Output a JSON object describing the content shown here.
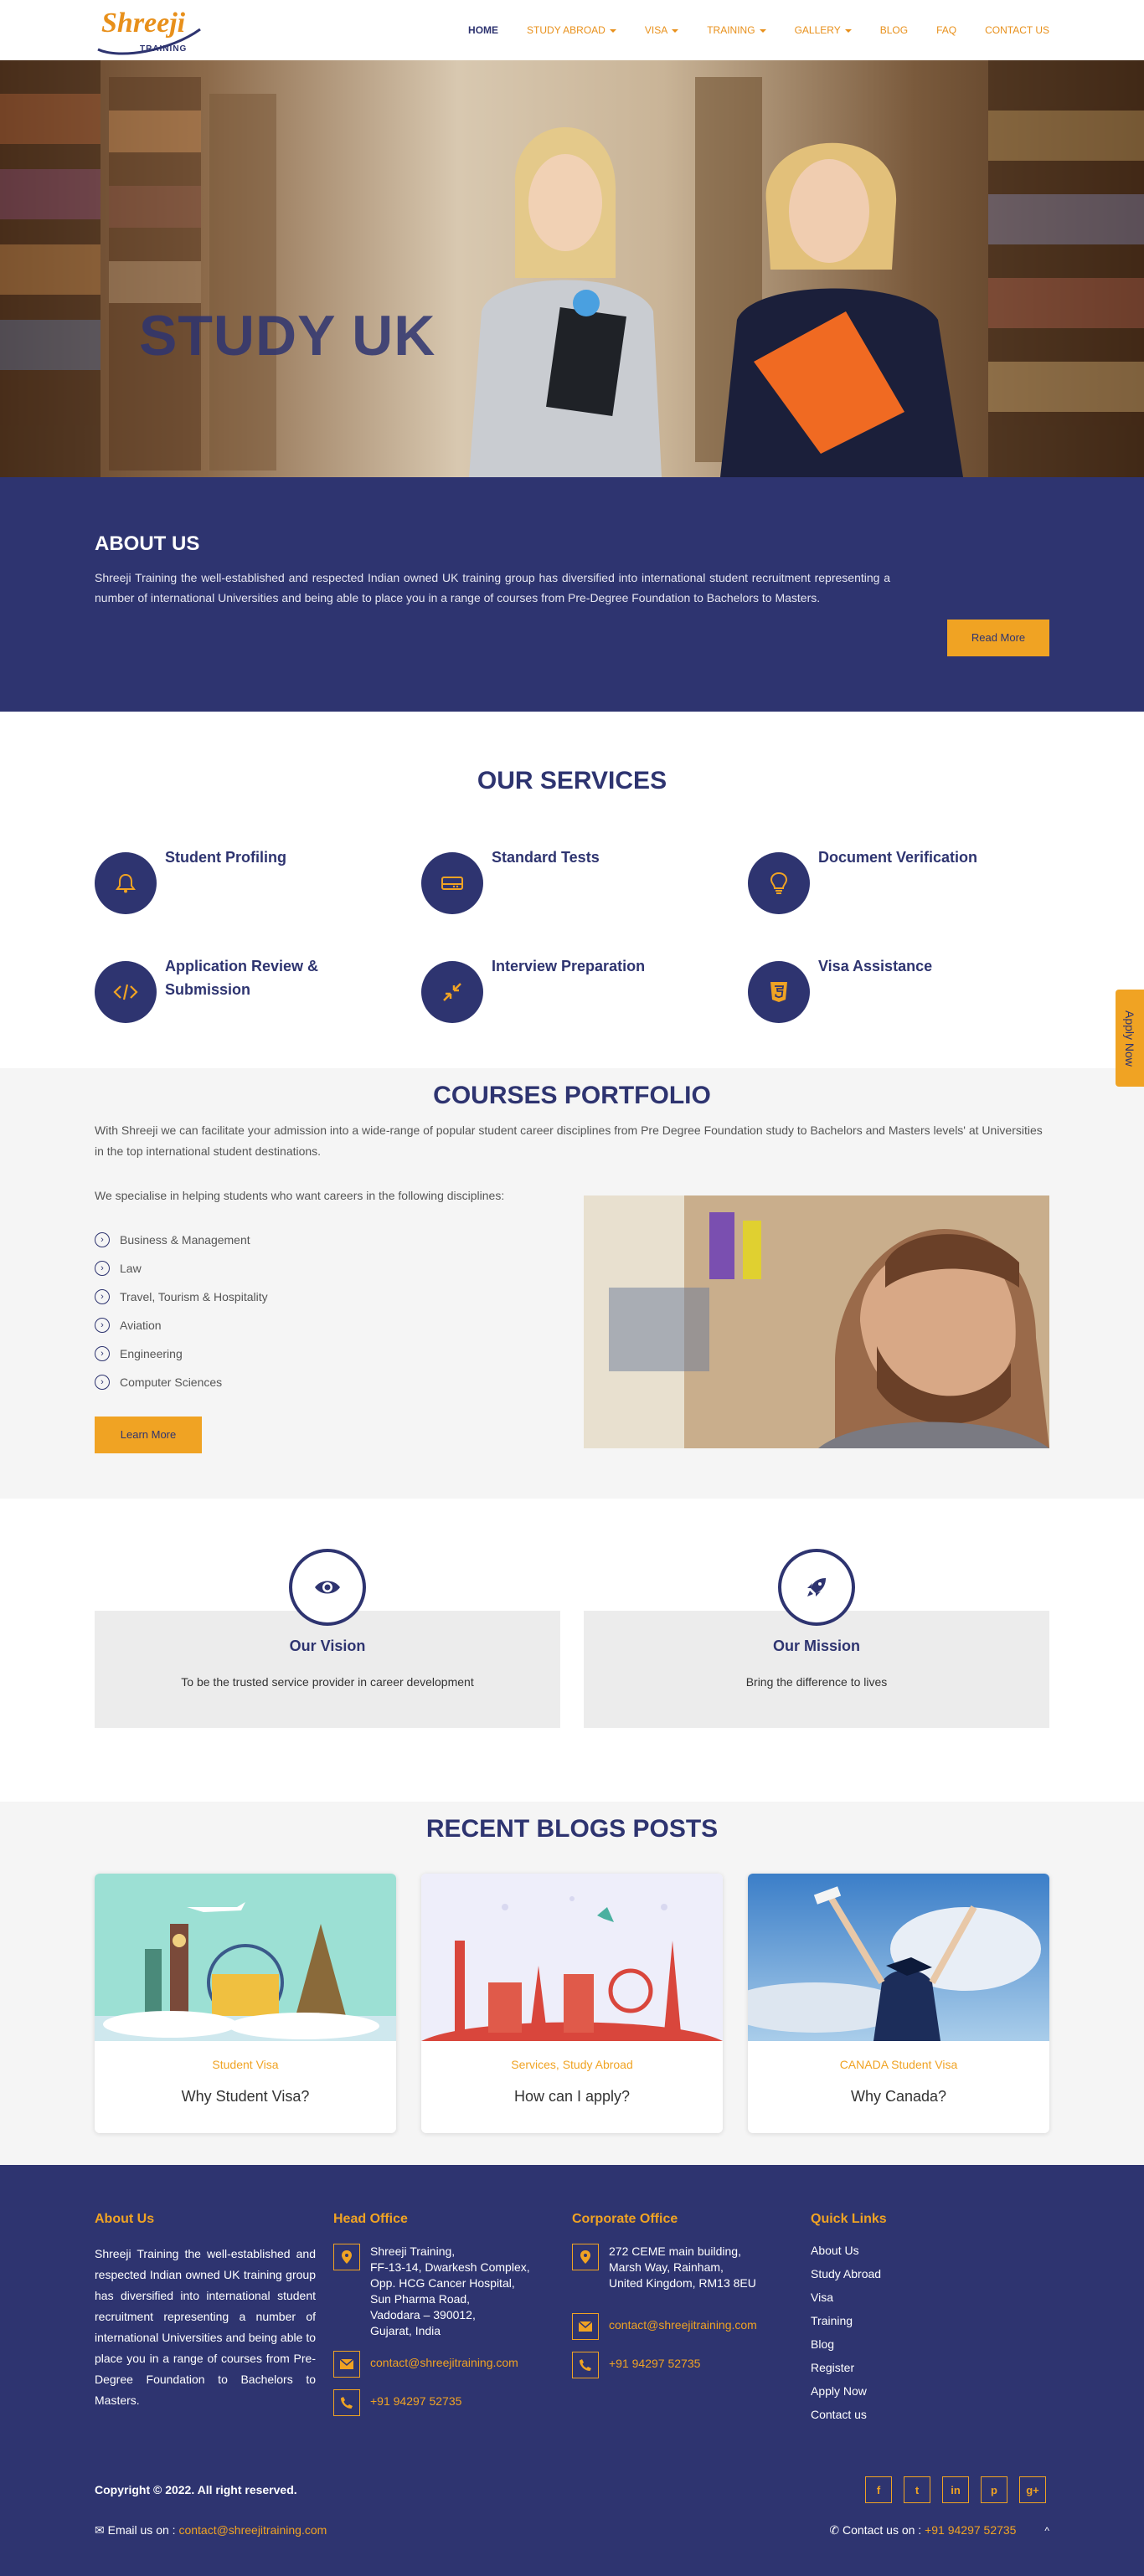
{
  "header": {
    "logo_text": "Shreeji",
    "logo_sub": "TRAINING",
    "nav": [
      {
        "label": "HOME",
        "active": true,
        "dropdown": false
      },
      {
        "label": "STUDY ABROAD",
        "active": false,
        "dropdown": true
      },
      {
        "label": "VISA",
        "active": false,
        "dropdown": true
      },
      {
        "label": "TRAINING",
        "active": false,
        "dropdown": true
      },
      {
        "label": "GALLERY",
        "active": false,
        "dropdown": true
      },
      {
        "label": "BLOG",
        "active": false,
        "dropdown": false
      },
      {
        "label": "FAQ",
        "active": false,
        "dropdown": false
      },
      {
        "label": "CONTACT US",
        "active": false,
        "dropdown": false
      }
    ]
  },
  "hero": {
    "title": "STUDY UK"
  },
  "about": {
    "heading": "ABOUT US",
    "text": "Shreeji Training the well-established and respected Indian owned UK training group has diversified into international student recruitment representing a number of international Universities and being able to place you in a range of courses from Pre-Degree Foundation to Bachelors to Masters.",
    "button": "Read More"
  },
  "services": {
    "heading": "OUR SERVICES",
    "items": [
      {
        "title": "Student Profiling",
        "icon": "bell-icon"
      },
      {
        "title": "Standard Tests",
        "icon": "hard-drive-icon"
      },
      {
        "title": "Document Verification",
        "icon": "lightbulb-icon"
      },
      {
        "title": "Application Review & Submission",
        "icon": "code-icon"
      },
      {
        "title": "Interview Preparation",
        "icon": "compress-icon"
      },
      {
        "title": "Visa Assistance",
        "icon": "html5-icon"
      }
    ]
  },
  "apply_tab": "Apply Now",
  "courses": {
    "heading": "COURSES PORTFOLIO",
    "intro": "With Shreeji we can facilitate your admission into a wide-range of popular student career disciplines from Pre Degree Foundation study to Bachelors and Masters levels' at Universities in the top international student destinations.",
    "lead": "We specialise in helping students who want careers in the following disciplines:",
    "disciplines": [
      "Business & Management",
      "Law",
      "Travel, Tourism & Hospitality",
      "Aviation",
      "Engineering",
      "Computer Sciences"
    ],
    "button": "Learn More"
  },
  "vision": {
    "title": "Our Vision",
    "text": "To be the trusted service provider in career development",
    "icon": "eye-icon"
  },
  "mission": {
    "title": "Our Mission",
    "text": "Bring the difference to lives",
    "icon": "rocket-icon"
  },
  "blogs": {
    "heading": "RECENT BLOGS POSTS",
    "posts": [
      {
        "category": "Student Visa",
        "title": "Why Student Visa?"
      },
      {
        "category": "Services, Study Abroad",
        "title": "How can I apply?"
      },
      {
        "category": "CANADA Student Visa",
        "title": "Why Canada?"
      }
    ]
  },
  "footer": {
    "about_heading": "About Us",
    "about_text": "Shreeji Training the well-established and respected Indian owned UK training group has diversified into international student recruitment representing a number of international Universities and being able to place you in a range of courses from Pre-Degree Foundation to Bachelors to Masters.",
    "head_heading": "Head Office",
    "head_address": [
      "Shreeji Training,",
      "FF-13-14, Dwarkesh Complex,",
      "Opp. HCG Cancer Hospital,",
      "Sun Pharma Road,",
      "Vadodara – 390012,",
      "Gujarat, India"
    ],
    "head_email": "contact@shreejitraining.com",
    "head_phone": "+91 94297 52735",
    "corp_heading": "Corporate Office",
    "corp_address": [
      "272 CEME main building,",
      "Marsh Way, Rainham,",
      "United Kingdom, RM13 8EU"
    ],
    "corp_email": "contact@shreejitraining.com",
    "corp_phone": "+91 94297 52735",
    "links_heading": "Quick Links",
    "links": [
      "About Us",
      "Study Abroad",
      "Visa",
      "Training",
      "Blog",
      "Register",
      "Apply Now",
      "Contact us"
    ],
    "copyright": "Copyright © 2022. All right reserved.",
    "socials": [
      "f",
      "t",
      "in",
      "p",
      "g+"
    ],
    "email_label": "Email us on :",
    "email": "contact@shreejitraining.com",
    "contact_label": "Contact us on :",
    "contact_phone": "+91 94297 52735",
    "scroll_up": "^"
  },
  "colors": {
    "primary": "#2e3470",
    "accent": "#f0a323"
  }
}
